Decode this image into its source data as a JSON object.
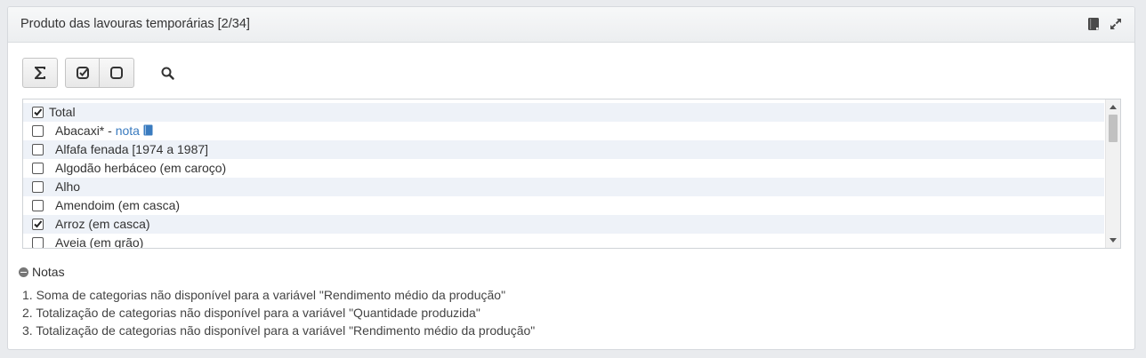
{
  "panel": {
    "title": "Produto das lavouras temporárias [2/34]",
    "icons": [
      "book-icon",
      "expand-icon"
    ]
  },
  "toolbar": {
    "buttons": [
      {
        "name": "sum",
        "icon": "sigma-icon"
      },
      {
        "name": "select-all",
        "icon": "check-square-icon"
      },
      {
        "name": "deselect-all",
        "icon": "empty-square-icon"
      },
      {
        "name": "search",
        "icon": "search-icon"
      }
    ]
  },
  "list": {
    "items": [
      {
        "label": "Total",
        "checked": true
      },
      {
        "label": "Abacaxi*",
        "checked": false,
        "separator": " - ",
        "note_link": "nota"
      },
      {
        "label": "Alfafa fenada [1974 a 1987]",
        "checked": false
      },
      {
        "label": "Algodão herbáceo (em caroço)",
        "checked": false
      },
      {
        "label": "Alho",
        "checked": false
      },
      {
        "label": "Amendoim (em casca)",
        "checked": false
      },
      {
        "label": "Arroz (em casca)",
        "checked": true
      },
      {
        "label": "Aveia (em grão)",
        "checked": false
      }
    ]
  },
  "notes": {
    "header": "Notas",
    "items": [
      "1. Soma de categorias não disponível para a variável \"Rendimento médio da produção\"",
      "2. Totalização de categorias não disponível para a variável \"Quantidade produzida\"",
      "3. Totalização de categorias não disponível para a variável \"Rendimento médio da produção\""
    ]
  },
  "colors": {
    "link": "#3a7bbf",
    "row_alt": "#eef2f8",
    "header_bg": "#eceef0"
  }
}
